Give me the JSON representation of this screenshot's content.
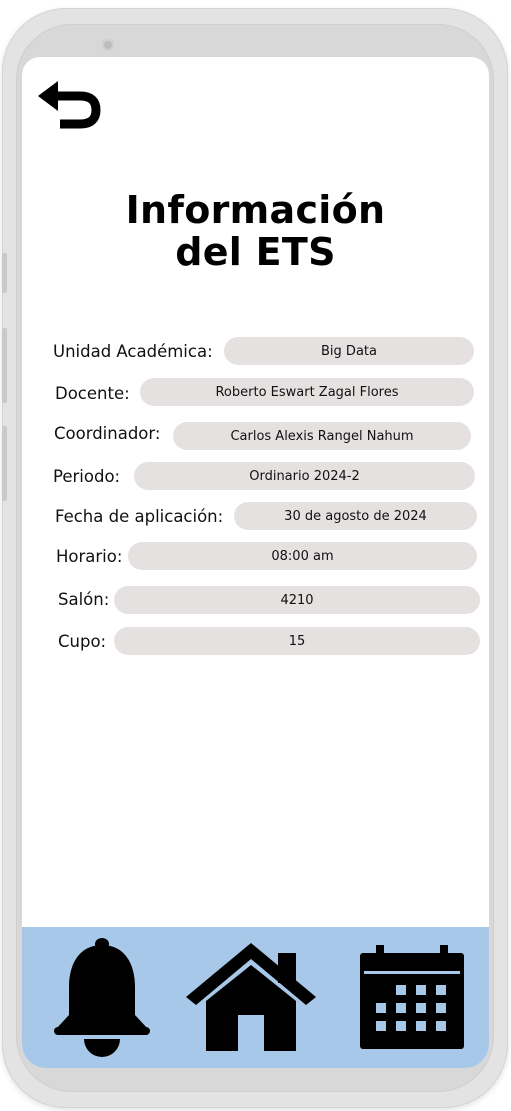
{
  "header": {
    "back_icon": "undo-arrow-icon",
    "title_line1": "Información",
    "title_line2": "del ETS"
  },
  "fields": [
    {
      "label": "Unidad Académica:",
      "value": "Big Data"
    },
    {
      "label": "Docente:",
      "value": "Roberto Eswart Zagal Flores"
    },
    {
      "label": "Coordinador:",
      "value": "Carlos Alexis Rangel Nahum"
    },
    {
      "label": "Periodo:",
      "value": "Ordinario 2024-2"
    },
    {
      "label": "Fecha de aplicación:",
      "value": "30 de agosto de 2024"
    },
    {
      "label": "Horario:",
      "value": "08:00 am"
    },
    {
      "label": "Salón:",
      "value": "4210"
    },
    {
      "label": "Cupo:",
      "value": "15"
    }
  ],
  "bottom_nav": {
    "background": "#a7c8e8",
    "items": [
      {
        "icon": "bell-icon"
      },
      {
        "icon": "home-icon"
      },
      {
        "icon": "calendar-icon"
      }
    ]
  }
}
